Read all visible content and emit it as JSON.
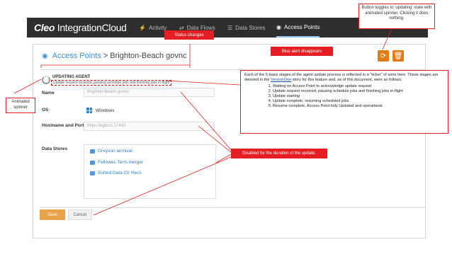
{
  "nav": {
    "brand_bold": "Cleo",
    "brand_rest": " IntegrationCloud",
    "items": [
      {
        "icon": "⚡",
        "label": "Activity"
      },
      {
        "icon": "⇄",
        "label": "Data Flows"
      },
      {
        "icon": "☰",
        "label": "Data Stores"
      },
      {
        "icon": "◉",
        "label": "Access Points"
      }
    ]
  },
  "page": {
    "section": "Access Points",
    "separator": ">",
    "name": "Brighton-Beach govnc"
  },
  "ticker": {
    "title": "UPDATING AGENT",
    "message": "Update request received, pausing schedule jobs and finishing jobs in-flight"
  },
  "form": {
    "name_label": "Name",
    "name_value": "Brighton-Beach govnc",
    "os_label": "OS",
    "os_value": "Windows",
    "host_label": "Hostname and Port",
    "host_value": "https://egloo1:17443",
    "stores_label": "Data Stores",
    "stores": [
      "Greyson archival",
      "Fellowes Term merger",
      "Sorted Data Ctr Recs"
    ]
  },
  "buttons": {
    "save": "Save",
    "cancel": "Cancel"
  },
  "annotations": {
    "status_changes": "Status changes",
    "blue_alert": "Blue alert disappears",
    "toggle_note": "Button toggles to 'updating' state with animated spinner. Clicking it does nothing.",
    "spinner_note": "Animated spinner",
    "disabled_note": "Disabled for the duration of the update.",
    "ticker_intro_a": "Each of the 5 basic stages of the agent update process is reflected in a \"ticker\" of sorts here. These stages are denoted in the ",
    "ticker_intro_link": "VersionOne",
    "ticker_intro_b": " story for this feature and, as of this document, were as follows:",
    "stages": [
      "Waiting on Access Point to acknowledge update request",
      "Update request received, pausing schedule jobs and finishing jobs in-flight",
      "Update starting",
      "Update complete, resuming scheduled jobs",
      "Resume complete, Access Point fully Updated and operational"
    ]
  },
  "colors": {
    "nav_bg": "#2e2e2e",
    "accent_blue": "#3d8fd1",
    "orange": "#e37b14",
    "annotation_red": "#e41e22"
  }
}
